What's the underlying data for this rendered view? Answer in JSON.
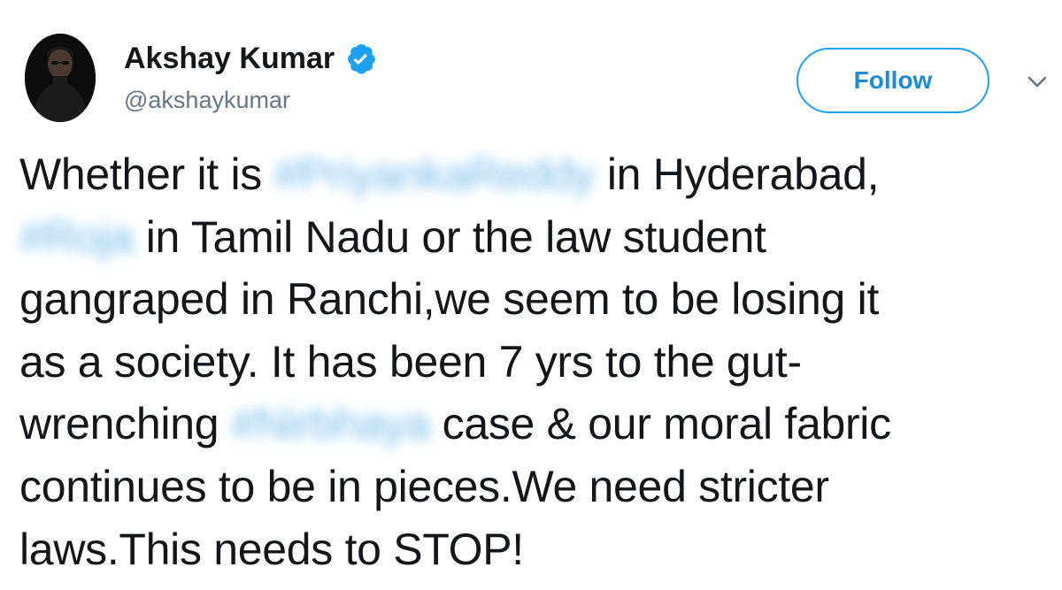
{
  "author": {
    "display_name": "Akshay Kumar",
    "handle": "@akshaykumar",
    "verified": true,
    "avatar": "profile-photo"
  },
  "header": {
    "follow_label": "Follow",
    "menu_icon": "chevron-down-icon"
  },
  "colors": {
    "accent": "#1da1f2",
    "follow_text": "#1b8bd6",
    "text": "#14171a",
    "muted": "#657786",
    "hashtag_blurred": "#5aaee8"
  },
  "tweet": {
    "segments": {
      "l1a": "Whether it is",
      "l1tag": "#PriyankaReddy",
      "l1b": "in Hyderabad,",
      "l2tag": "#Roja",
      "l2b": "in Tamil Nadu or the law student",
      "l3": "gangraped in Ranchi,we seem to be losing it",
      "l4": "as a society. It has been 7 yrs to the gut-",
      "l5a": "wrenching",
      "l5tag": "#Nirbhaya",
      "l5b": "case & our moral fabric",
      "l6": "continues to be in pieces.We need stricter",
      "l7": "laws.This needs to STOP!"
    }
  }
}
